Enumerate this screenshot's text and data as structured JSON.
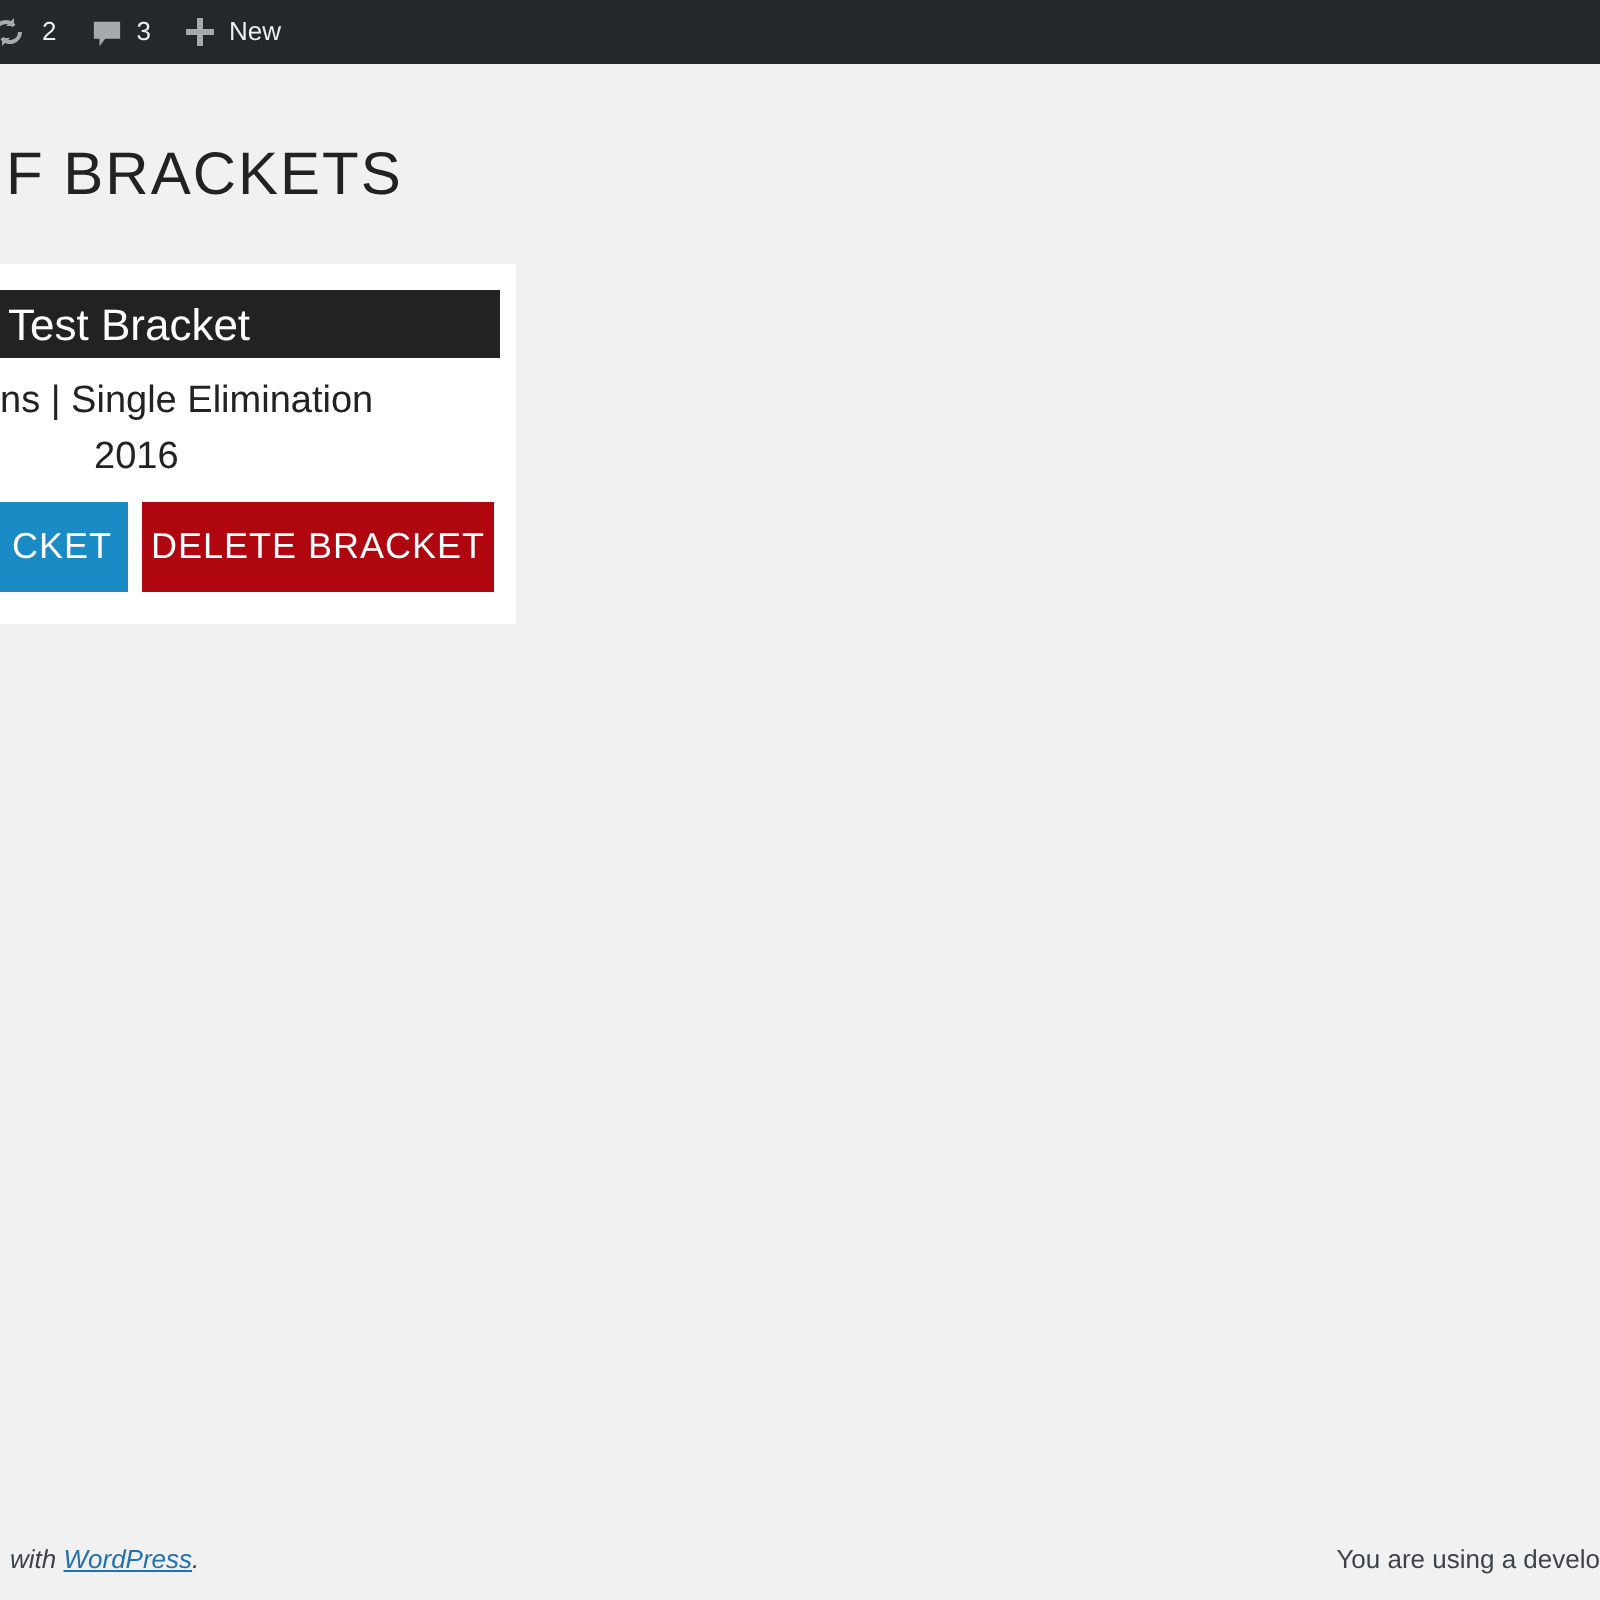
{
  "admin_bar": {
    "items": [
      {
        "kind": "updates",
        "label": "2"
      },
      {
        "kind": "comments",
        "label": "3"
      },
      {
        "kind": "new",
        "label": "New"
      }
    ]
  },
  "page_title": "F BRACKETS",
  "bracket_card": {
    "title": "Test Bracket",
    "meta": "ns | Single Elimination",
    "year": "2016",
    "buttons": [
      {
        "kind": "edit",
        "label": "CKET"
      },
      {
        "kind": "delete",
        "label": "DELETE BRACKET"
      }
    ]
  },
  "footer": {
    "prefix": "with",
    "link": "WordPress",
    "suffix": ".",
    "version_note": "You are using a develo"
  }
}
